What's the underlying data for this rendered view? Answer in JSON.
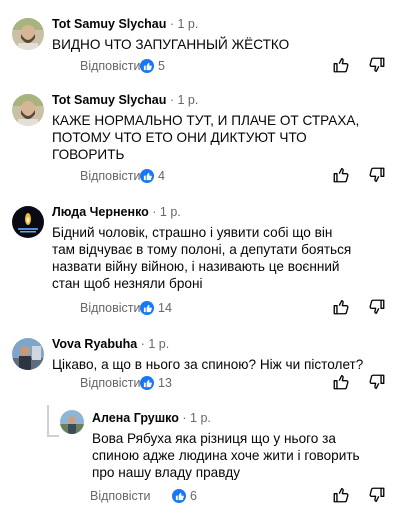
{
  "comments": [
    {
      "author": "Tot Samuy Slychau",
      "time": "· 1 р.",
      "text": "ВИДНО ЧТО ЗАПУГАННЫЙ ЖЁСТКО",
      "reply_label": "Відповісти",
      "likes": "5",
      "avatar_icon": "bearded-man-avatar"
    },
    {
      "author": "Tot Samuy Slychau",
      "time": "· 1 р.",
      "text": "КАЖЕ НОРМАЛЬНО ТУТ, И ПЛАЧЕ ОТ СТРАХА,\nПОТОМУ ЧТО ЕТО ОНИ ДИКТУЮТ ЧТО\nГОВОРИТЬ",
      "reply_label": "Відповісти",
      "likes": "4",
      "avatar_icon": "bearded-man-avatar"
    },
    {
      "author": "Люда Черненко",
      "time": "· 1 р.",
      "text": "Бідний чоловік, страшно і  уявити  собі   що він\nтам  відчуває в тому полоні, а депутати бояться\nназвати війну війною, і називають це воєнний\nстан  щоб незняли броні",
      "reply_label": "Відповісти",
      "likes": "14",
      "avatar_icon": "candle-avatar"
    },
    {
      "author": "Vova  Ryabuha",
      "time": "· 1 р.",
      "text": "Цікаво, а що в нього за спиною? Ніж чи пістолет?",
      "reply_label": "Відповісти",
      "likes": "13",
      "avatar_icon": "man-landscape-avatar"
    },
    {
      "author": "Алена Грушко",
      "time": "· 1 р.",
      "text": "Вова Рябуха яка різниця що у нього за\nспиною адже людина хоче жити і говорить\nпро нашу владу правду",
      "reply_label": "Відповісти",
      "likes": "6",
      "avatar_icon": "outdoor-photo-avatar"
    }
  ],
  "icons": {
    "like_action": "thumbs-up-outline-icon",
    "dislike_action": "thumbs-down-outline-icon",
    "like_badge": "blue-thumbs-up-icon"
  },
  "colors": {
    "like_blue": "#1877f2",
    "secondary_text": "#65676b"
  }
}
